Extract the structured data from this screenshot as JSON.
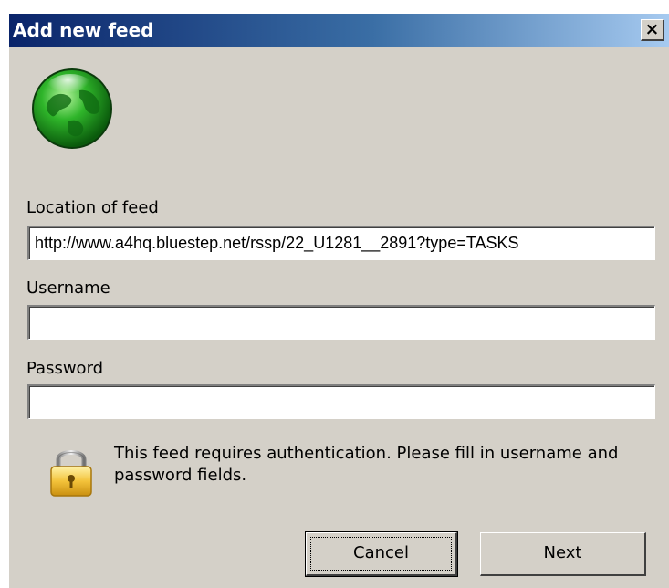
{
  "window": {
    "title": "Add new feed",
    "close_glyph": "×"
  },
  "icons": {
    "feed_icon": "globe-icon",
    "lock_icon": "padlock-icon"
  },
  "form": {
    "location": {
      "label": "Location of feed",
      "value": "http://www.a4hq.bluestep.net/rssp/22_U1281__2891?type=TASKS"
    },
    "username": {
      "label": "Username",
      "value": ""
    },
    "password": {
      "label": "Password",
      "value": ""
    }
  },
  "auth_message": "This feed requires authentication. Please fill in username and password fields.",
  "buttons": {
    "cancel_label": "Cancel",
    "next_label": "Next"
  },
  "colors": {
    "title_gradient_start": "#0a246a",
    "title_gradient_end": "#a6caf0",
    "dialog_background": "#d4d0c8"
  }
}
